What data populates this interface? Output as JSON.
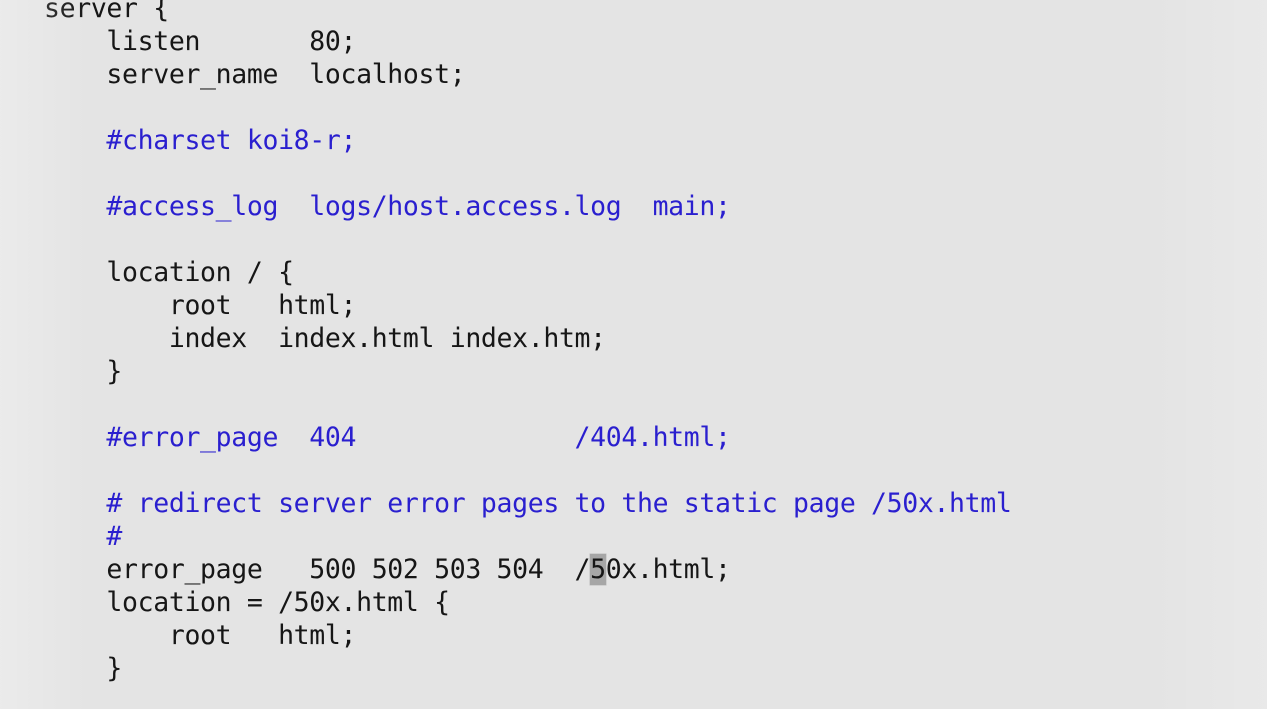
{
  "app": {
    "kind": "text-editor-code-view",
    "language": "nginx-conf",
    "background_color": "#e4e4e4",
    "code_color": "#161616",
    "comment_color": "#2a1fcf",
    "cursor_color": "#a6a6a6"
  },
  "cursor": {
    "line_index": 16,
    "character": "5",
    "column": 31
  },
  "code": {
    "lines": [
      {
        "index": 0,
        "type": "code",
        "text": "server {"
      },
      {
        "index": 1,
        "type": "code",
        "text": "    listen       80;"
      },
      {
        "index": 2,
        "type": "code",
        "text": "    server_name  localhost;"
      },
      {
        "index": 3,
        "type": "blank",
        "text": ""
      },
      {
        "index": 4,
        "type": "comment",
        "text": "    #charset koi8-r;"
      },
      {
        "index": 5,
        "type": "blank",
        "text": ""
      },
      {
        "index": 6,
        "type": "comment",
        "text": "    #access_log  logs/host.access.log  main;"
      },
      {
        "index": 7,
        "type": "blank",
        "text": ""
      },
      {
        "index": 8,
        "type": "code",
        "text": "    location / {"
      },
      {
        "index": 9,
        "type": "code",
        "text": "        root   html;"
      },
      {
        "index": 10,
        "type": "code",
        "text": "        index  index.html index.htm;"
      },
      {
        "index": 11,
        "type": "code",
        "text": "    }"
      },
      {
        "index": 12,
        "type": "blank",
        "text": ""
      },
      {
        "index": 13,
        "type": "comment",
        "text": "    #error_page  404              /404.html;"
      },
      {
        "index": 14,
        "type": "blank",
        "text": ""
      },
      {
        "index": 15,
        "type": "comment",
        "text": "    # redirect server error pages to the static page /50x.html"
      },
      {
        "index": 16,
        "type": "comment",
        "text": "    #"
      },
      {
        "index": 17,
        "type": "code",
        "text": "    error_page   500 502 503 504  /50x.html;"
      },
      {
        "index": 18,
        "type": "code",
        "text": "    location = /50x.html {"
      },
      {
        "index": 19,
        "type": "code",
        "text": "        root   html;"
      },
      {
        "index": 20,
        "type": "code",
        "text": "    }"
      }
    ],
    "cursor_line": {
      "prefix": "    error_page   500 502 503 504  /",
      "cursor_char": "5",
      "suffix": "0x.html;"
    }
  }
}
